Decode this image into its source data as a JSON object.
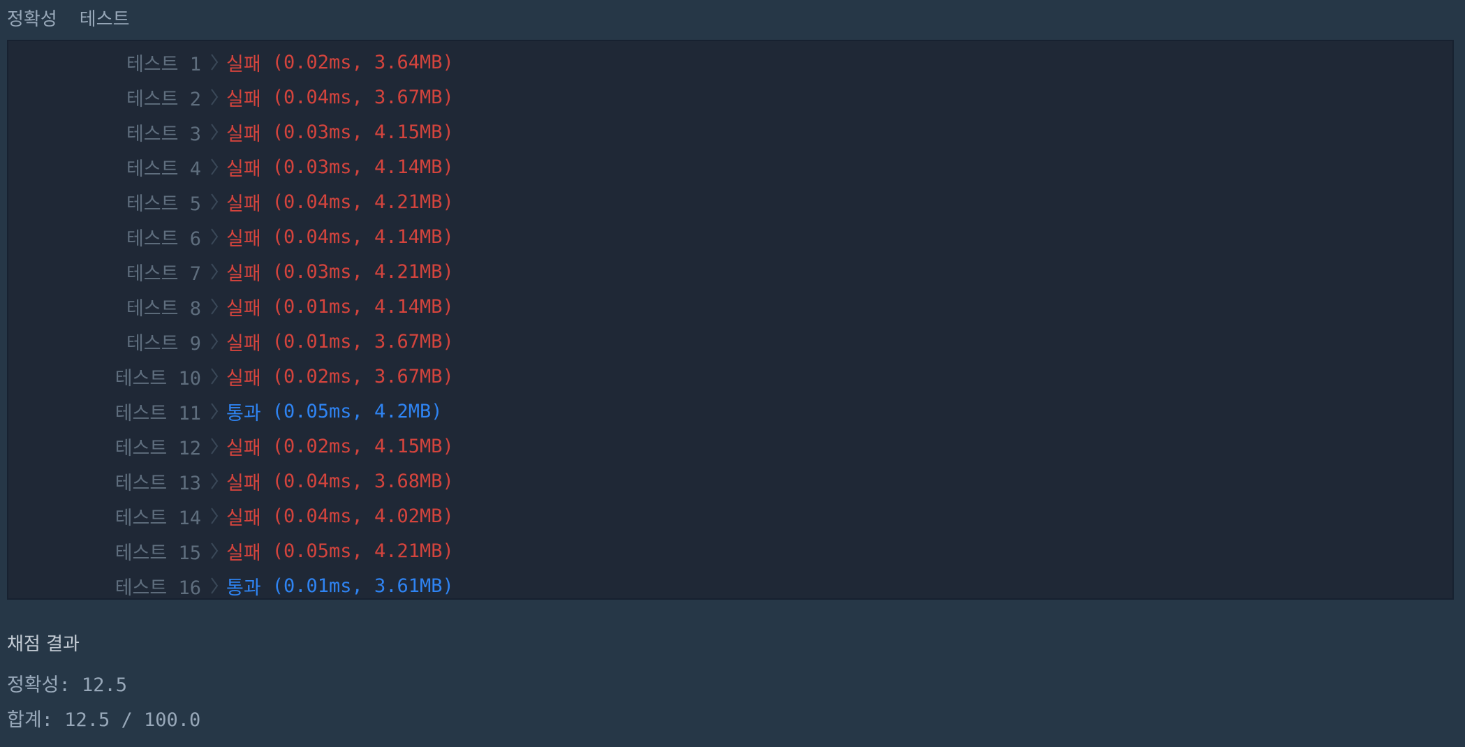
{
  "header": {
    "tabs": [
      {
        "label": "정확성"
      },
      {
        "label": "테스트"
      }
    ]
  },
  "results": [
    {
      "name": "테스트 1",
      "status": "실패",
      "metrics": "(0.02ms, 3.64MB)",
      "pass": false
    },
    {
      "name": "테스트 2",
      "status": "실패",
      "metrics": "(0.04ms, 3.67MB)",
      "pass": false
    },
    {
      "name": "테스트 3",
      "status": "실패",
      "metrics": "(0.03ms, 4.15MB)",
      "pass": false
    },
    {
      "name": "테스트 4",
      "status": "실패",
      "metrics": "(0.03ms, 4.14MB)",
      "pass": false
    },
    {
      "name": "테스트 5",
      "status": "실패",
      "metrics": "(0.04ms, 4.21MB)",
      "pass": false
    },
    {
      "name": "테스트 6",
      "status": "실패",
      "metrics": "(0.04ms, 4.14MB)",
      "pass": false
    },
    {
      "name": "테스트 7",
      "status": "실패",
      "metrics": "(0.03ms, 4.21MB)",
      "pass": false
    },
    {
      "name": "테스트 8",
      "status": "실패",
      "metrics": "(0.01ms, 4.14MB)",
      "pass": false
    },
    {
      "name": "테스트 9",
      "status": "실패",
      "metrics": "(0.01ms, 3.67MB)",
      "pass": false
    },
    {
      "name": "테스트 10",
      "status": "실패",
      "metrics": "(0.02ms, 3.67MB)",
      "pass": false
    },
    {
      "name": "테스트 11",
      "status": "통과",
      "metrics": "(0.05ms, 4.2MB)",
      "pass": true
    },
    {
      "name": "테스트 12",
      "status": "실패",
      "metrics": "(0.02ms, 4.15MB)",
      "pass": false
    },
    {
      "name": "테스트 13",
      "status": "실패",
      "metrics": "(0.04ms, 3.68MB)",
      "pass": false
    },
    {
      "name": "테스트 14",
      "status": "실패",
      "metrics": "(0.04ms, 4.02MB)",
      "pass": false
    },
    {
      "name": "테스트 15",
      "status": "실패",
      "metrics": "(0.05ms, 4.21MB)",
      "pass": false
    },
    {
      "name": "테스트 16",
      "status": "통과",
      "metrics": "(0.01ms, 3.61MB)",
      "pass": true
    }
  ],
  "summary": {
    "title": "채점 결과",
    "accuracy": "정확성: 12.5",
    "total": "합계: 12.5 / 100.0"
  },
  "colors": {
    "background": "#263747",
    "panel": "#1f2836",
    "fail": "#d4443d",
    "pass": "#2f84f3",
    "label": "#5f6e7e"
  },
  "icons": {
    "row_separator": "chevron-right-icon"
  }
}
